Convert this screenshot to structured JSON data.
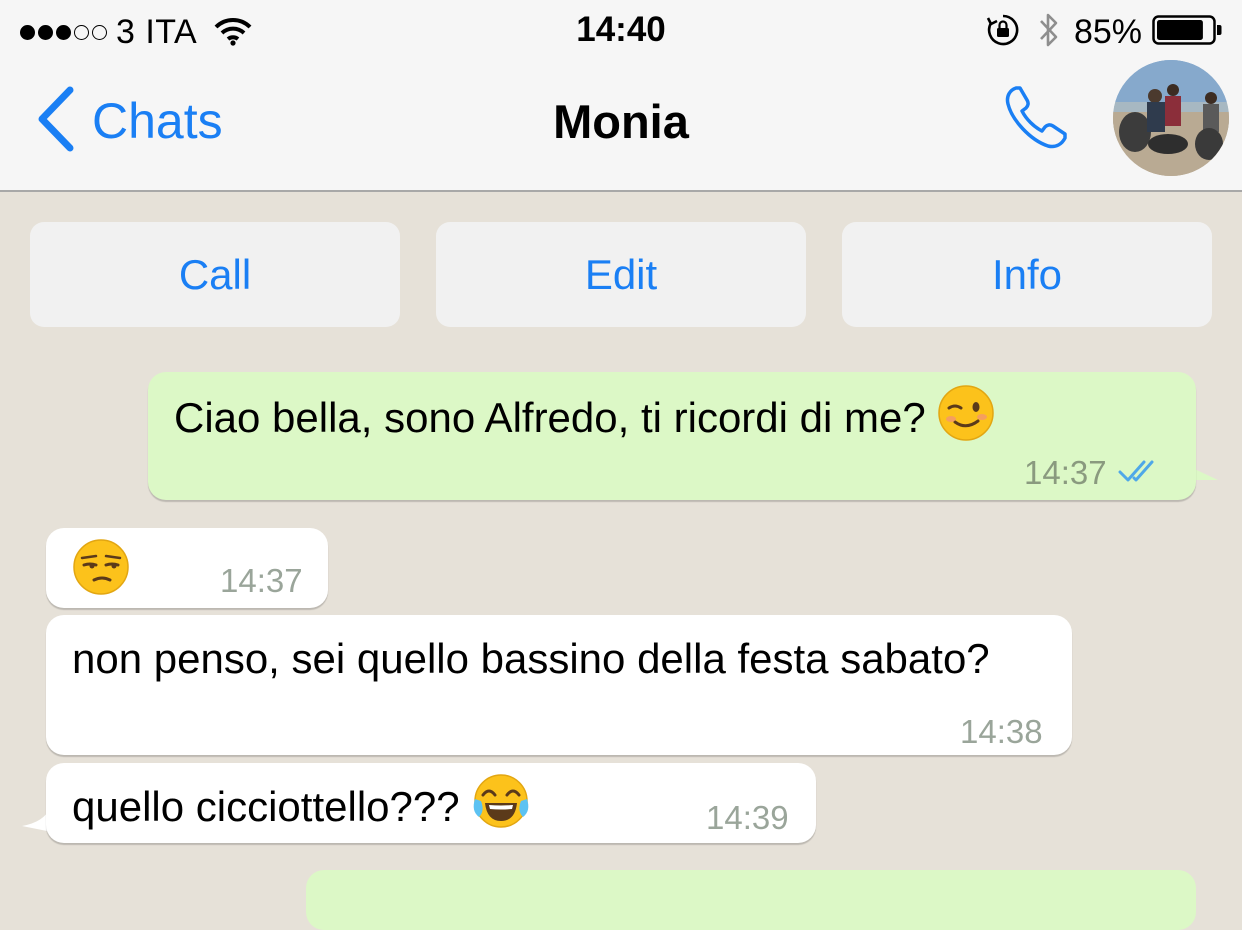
{
  "status_bar": {
    "signal": "●●●○○",
    "carrier": "3 ITA",
    "time": "14:40",
    "battery": "85%",
    "battery_level": 0.85
  },
  "nav": {
    "back_label": "Chats",
    "title": "Monia"
  },
  "actions": {
    "call": "Call",
    "edit": "Edit",
    "info": "Info"
  },
  "messages": [
    {
      "direction": "outgoing",
      "text": "Ciao bella, sono Alfredo, ti ricordi di me?",
      "emoji": "winking-face",
      "time": "14:37",
      "status": "read"
    },
    {
      "direction": "incoming",
      "text": "",
      "emoji": "unamused-face",
      "time": "14:37"
    },
    {
      "direction": "incoming",
      "text": "non penso, sei quello bassino della festa sabato?",
      "time": "14:38"
    },
    {
      "direction": "incoming",
      "text": "quello cicciottello???",
      "emoji": "face-with-tears-of-joy",
      "time": "14:39"
    }
  ],
  "colors": {
    "accent": "#1a7ff4",
    "chat_background": "#e6e1d8",
    "outgoing_bubble": "#dcf8c6",
    "incoming_bubble": "#ffffff",
    "read_ticks": "#4fa8e8"
  }
}
